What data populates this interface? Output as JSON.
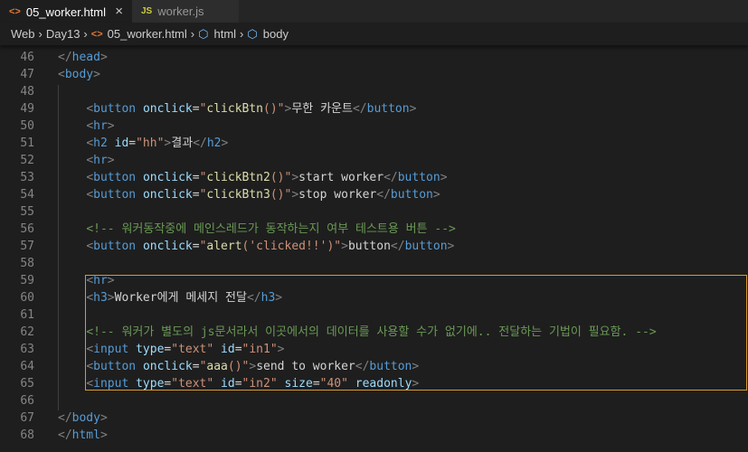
{
  "tabs": [
    {
      "label": "05_worker.html",
      "icon": "html-icon",
      "active": true
    },
    {
      "label": "worker.js",
      "icon": "js-icon",
      "active": false
    }
  ],
  "breadcrumb": [
    "Web",
    "Day13",
    "05_worker.html",
    "html",
    "body"
  ],
  "colors": {
    "background": "#1e1e1e",
    "tag": "#569cd6",
    "attribute": "#9cdcfe",
    "string": "#ce9178",
    "function": "#dcdcaa",
    "comment": "#6a9955",
    "selection_border": "#d89a2b"
  },
  "code_lines": [
    {
      "n": "46",
      "tokens": [
        [
          "tag",
          "</"
        ],
        [
          "tname",
          "head"
        ],
        [
          "tag",
          ">"
        ]
      ]
    },
    {
      "n": "47",
      "tokens": [
        [
          "tag",
          "<"
        ],
        [
          "tname",
          "body"
        ],
        [
          "tag",
          ">"
        ]
      ]
    },
    {
      "n": "48",
      "tokens": []
    },
    {
      "n": "49",
      "tokens": [
        [
          "txt",
          "    "
        ],
        [
          "tag",
          "<"
        ],
        [
          "tname",
          "button"
        ],
        [
          "txt",
          " "
        ],
        [
          "attr",
          "onclick"
        ],
        [
          "txt",
          "="
        ],
        [
          "str",
          "\""
        ],
        [
          "fn",
          "clickBtn"
        ],
        [
          "str",
          "()\""
        ],
        [
          "tag",
          ">"
        ],
        [
          "txt",
          "무한 카운트"
        ],
        [
          "tag",
          "</"
        ],
        [
          "tname",
          "button"
        ],
        [
          "tag",
          ">"
        ]
      ]
    },
    {
      "n": "50",
      "tokens": [
        [
          "txt",
          "    "
        ],
        [
          "tag",
          "<"
        ],
        [
          "tname",
          "hr"
        ],
        [
          "tag",
          ">"
        ]
      ]
    },
    {
      "n": "51",
      "tokens": [
        [
          "txt",
          "    "
        ],
        [
          "tag",
          "<"
        ],
        [
          "tname",
          "h2"
        ],
        [
          "txt",
          " "
        ],
        [
          "attr",
          "id"
        ],
        [
          "txt",
          "="
        ],
        [
          "str",
          "\"hh\""
        ],
        [
          "tag",
          ">"
        ],
        [
          "txt",
          "결과"
        ],
        [
          "tag",
          "</"
        ],
        [
          "tname",
          "h2"
        ],
        [
          "tag",
          ">"
        ]
      ]
    },
    {
      "n": "52",
      "tokens": [
        [
          "txt",
          "    "
        ],
        [
          "tag",
          "<"
        ],
        [
          "tname",
          "hr"
        ],
        [
          "tag",
          ">"
        ]
      ]
    },
    {
      "n": "53",
      "tokens": [
        [
          "txt",
          "    "
        ],
        [
          "tag",
          "<"
        ],
        [
          "tname",
          "button"
        ],
        [
          "txt",
          " "
        ],
        [
          "attr",
          "onclick"
        ],
        [
          "txt",
          "="
        ],
        [
          "str",
          "\""
        ],
        [
          "fn",
          "clickBtn2"
        ],
        [
          "str",
          "()\""
        ],
        [
          "tag",
          ">"
        ],
        [
          "txt",
          "start worker"
        ],
        [
          "tag",
          "</"
        ],
        [
          "tname",
          "button"
        ],
        [
          "tag",
          ">"
        ]
      ]
    },
    {
      "n": "54",
      "tokens": [
        [
          "txt",
          "    "
        ],
        [
          "tag",
          "<"
        ],
        [
          "tname",
          "button"
        ],
        [
          "txt",
          " "
        ],
        [
          "attr",
          "onclick"
        ],
        [
          "txt",
          "="
        ],
        [
          "str",
          "\""
        ],
        [
          "fn",
          "clickBtn3"
        ],
        [
          "str",
          "()\""
        ],
        [
          "tag",
          ">"
        ],
        [
          "txt",
          "stop worker"
        ],
        [
          "tag",
          "</"
        ],
        [
          "tname",
          "button"
        ],
        [
          "tag",
          ">"
        ]
      ]
    },
    {
      "n": "55",
      "tokens": []
    },
    {
      "n": "56",
      "tokens": [
        [
          "txt",
          "    "
        ],
        [
          "comment",
          "<!-- 워커동작중에 메인스레드가 동작하는지 여부 테스트용 버튼 -->"
        ]
      ]
    },
    {
      "n": "57",
      "tokens": [
        [
          "txt",
          "    "
        ],
        [
          "tag",
          "<"
        ],
        [
          "tname",
          "button"
        ],
        [
          "txt",
          " "
        ],
        [
          "attr",
          "onclick"
        ],
        [
          "txt",
          "="
        ],
        [
          "str",
          "\""
        ],
        [
          "fn",
          "alert"
        ],
        [
          "str",
          "('clicked!!')\""
        ],
        [
          "tag",
          ">"
        ],
        [
          "txt",
          "button"
        ],
        [
          "tag",
          "</"
        ],
        [
          "tname",
          "button"
        ],
        [
          "tag",
          ">"
        ]
      ]
    },
    {
      "n": "58",
      "tokens": []
    },
    {
      "n": "59",
      "tokens": [
        [
          "txt",
          "    "
        ],
        [
          "tag",
          "<"
        ],
        [
          "tname",
          "hr"
        ],
        [
          "tag",
          ">"
        ]
      ]
    },
    {
      "n": "60",
      "tokens": [
        [
          "txt",
          "    "
        ],
        [
          "tag",
          "<"
        ],
        [
          "tname",
          "h3"
        ],
        [
          "tag",
          ">"
        ],
        [
          "txt",
          "Worker에게 메세지 전달"
        ],
        [
          "tag",
          "</"
        ],
        [
          "tname",
          "h3"
        ],
        [
          "tag",
          ">"
        ]
      ]
    },
    {
      "n": "61",
      "tokens": []
    },
    {
      "n": "62",
      "tokens": [
        [
          "txt",
          "    "
        ],
        [
          "comment",
          "<!-- 워커가 별도의 js문서라서 이곳에서의 데이터를 사용할 수가 없기에.. 전달하는 기법이 필요함. -->"
        ]
      ]
    },
    {
      "n": "63",
      "tokens": [
        [
          "txt",
          "    "
        ],
        [
          "tag",
          "<"
        ],
        [
          "tname",
          "input"
        ],
        [
          "txt",
          " "
        ],
        [
          "attr",
          "type"
        ],
        [
          "txt",
          "="
        ],
        [
          "str",
          "\"text\""
        ],
        [
          "txt",
          " "
        ],
        [
          "attr",
          "id"
        ],
        [
          "txt",
          "="
        ],
        [
          "str",
          "\"in1\""
        ],
        [
          "tag",
          ">"
        ]
      ]
    },
    {
      "n": "64",
      "tokens": [
        [
          "txt",
          "    "
        ],
        [
          "tag",
          "<"
        ],
        [
          "tname",
          "button"
        ],
        [
          "txt",
          " "
        ],
        [
          "attr",
          "onclick"
        ],
        [
          "txt",
          "="
        ],
        [
          "str",
          "\""
        ],
        [
          "fn",
          "aaa"
        ],
        [
          "str",
          "()\""
        ],
        [
          "tag",
          ">"
        ],
        [
          "txt",
          "send to worker"
        ],
        [
          "tag",
          "</"
        ],
        [
          "tname",
          "button"
        ],
        [
          "tag",
          ">"
        ]
      ]
    },
    {
      "n": "65",
      "tokens": [
        [
          "txt",
          "    "
        ],
        [
          "tag",
          "<"
        ],
        [
          "tname",
          "input"
        ],
        [
          "txt",
          " "
        ],
        [
          "attr",
          "type"
        ],
        [
          "txt",
          "="
        ],
        [
          "str",
          "\"text\""
        ],
        [
          "txt",
          " "
        ],
        [
          "attr",
          "id"
        ],
        [
          "txt",
          "="
        ],
        [
          "str",
          "\"in2\""
        ],
        [
          "txt",
          " "
        ],
        [
          "attr",
          "size"
        ],
        [
          "txt",
          "="
        ],
        [
          "str",
          "\"40\""
        ],
        [
          "txt",
          " "
        ],
        [
          "attr",
          "readonly"
        ],
        [
          "tag",
          ">"
        ]
      ]
    },
    {
      "n": "66",
      "tokens": []
    },
    {
      "n": "67",
      "tokens": [
        [
          "tag",
          "</"
        ],
        [
          "tname",
          "body"
        ],
        [
          "tag",
          ">"
        ]
      ]
    },
    {
      "n": "68",
      "tokens": [
        [
          "tag",
          "</"
        ],
        [
          "tname",
          "html"
        ],
        [
          "tag",
          ">"
        ]
      ]
    }
  ]
}
